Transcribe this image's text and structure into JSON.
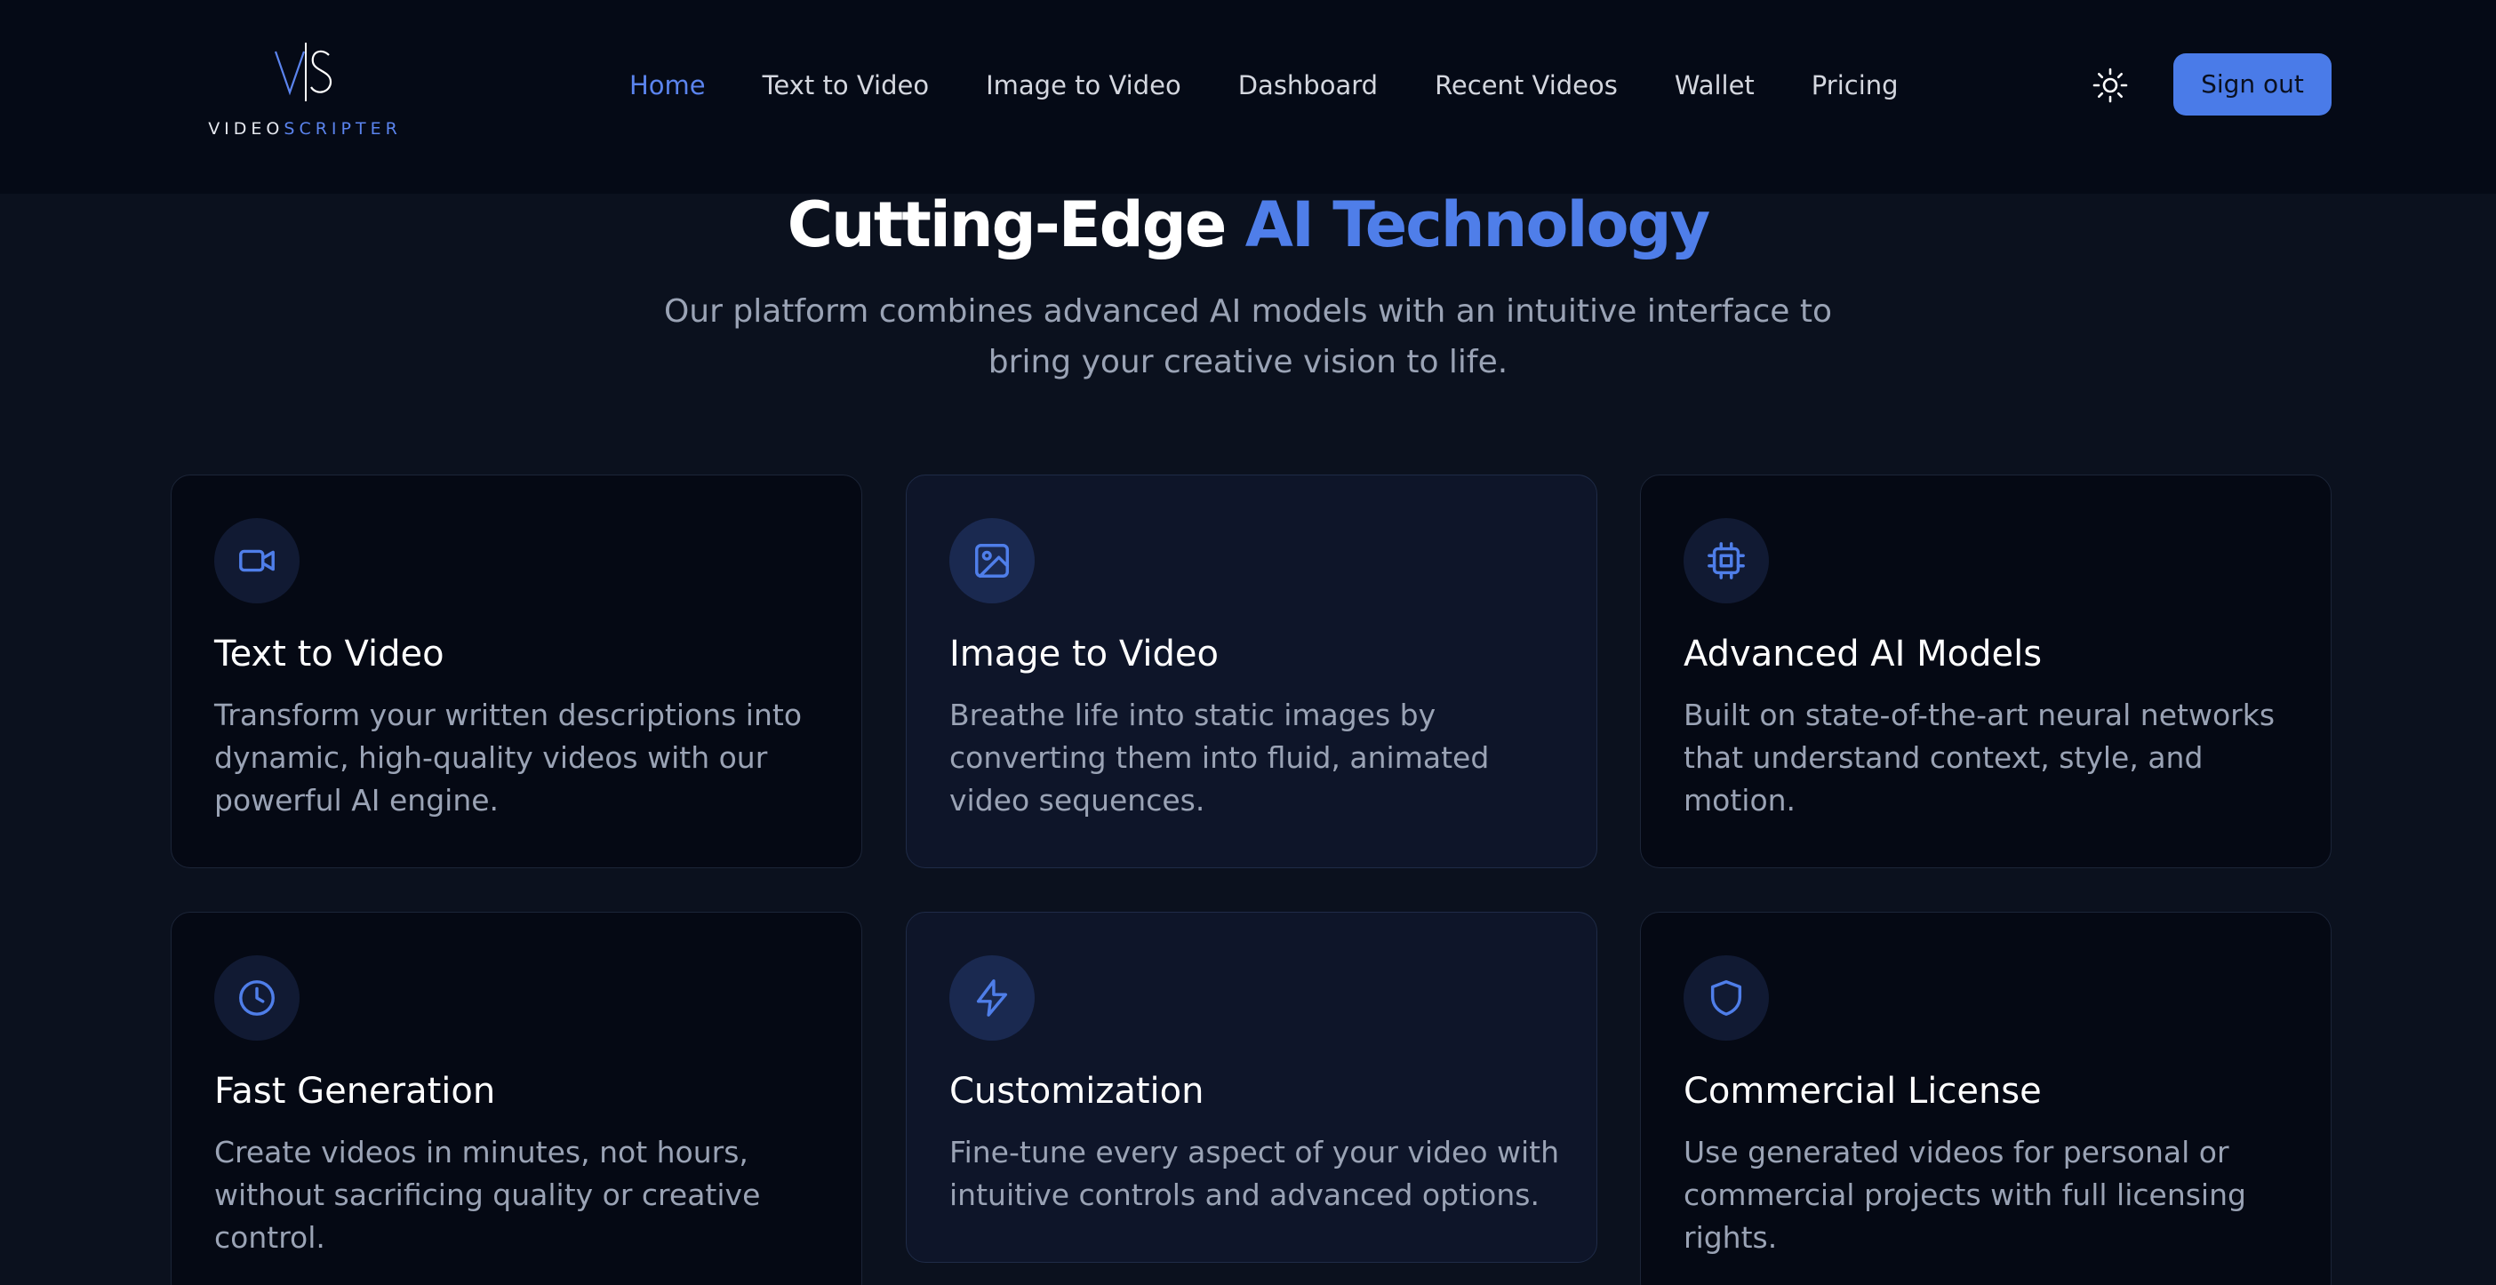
{
  "brand": {
    "mark": "V|S",
    "word_part1": "VIDEO",
    "word_part2": "SCRIPTER"
  },
  "nav": {
    "items": [
      {
        "label": "Home",
        "active": true
      },
      {
        "label": "Text to Video",
        "active": false
      },
      {
        "label": "Image to Video",
        "active": false
      },
      {
        "label": "Dashboard",
        "active": false
      },
      {
        "label": "Recent Videos",
        "active": false
      },
      {
        "label": "Wallet",
        "active": false
      },
      {
        "label": "Pricing",
        "active": false
      }
    ],
    "theme_icon": "sun-icon",
    "signout_label": "Sign out"
  },
  "hero": {
    "title_part1": "Cutting-Edge",
    "title_part2": "AI Technology",
    "subtitle_line1": "Our platform combines advanced AI models with an intuitive interface to",
    "subtitle_line2": "bring your creative vision to life."
  },
  "features": [
    {
      "icon": "video-camera-icon",
      "title": "Text to Video",
      "desc_lines": [
        "Transform your written descriptions into",
        "dynamic, high-quality videos with our",
        "powerful AI engine."
      ]
    },
    {
      "icon": "image-icon",
      "title": "Image to Video",
      "desc_lines": [
        "Breathe life into static images by",
        "converting them into fluid, animated",
        "video sequences."
      ]
    },
    {
      "icon": "cpu-chip-icon",
      "title": "Advanced AI Models",
      "desc_lines": [
        "Built on state-of-the-art neural networks",
        "that understand context, style, and",
        "motion."
      ]
    },
    {
      "icon": "clock-icon",
      "title": "Fast Generation",
      "desc_lines": [
        "Create videos in minutes, not hours,",
        "without sacrificing quality or creative",
        "control."
      ]
    },
    {
      "icon": "lightning-icon",
      "title": "Customization",
      "desc_lines": [
        "Fine-tune every aspect of your video with",
        "intuitive controls and advanced options."
      ]
    },
    {
      "icon": "shield-icon",
      "title": "Commercial License",
      "desc_lines": [
        "Use generated videos for personal or",
        "commercial projects with full licensing",
        "rights."
      ]
    }
  ],
  "colors": {
    "accent": "#4f7ee9",
    "background": "#0b111e",
    "header": "#050a16",
    "card": "#050914",
    "card_tint": "#0e1529",
    "muted_text": "#9aa3b5"
  }
}
